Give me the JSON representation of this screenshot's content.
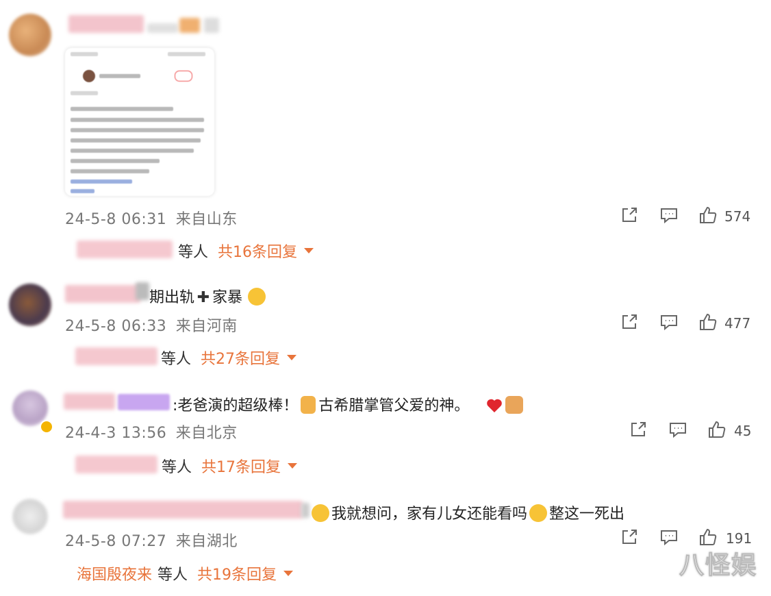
{
  "comments": [
    {
      "timestamp": "24-5-8 06:31",
      "location": "来自山东",
      "share_count": "",
      "comment_count": "",
      "likes": "574",
      "reply_who": "等人",
      "reply_total": "共16条回复"
    },
    {
      "text_a": "期出轨",
      "text_b": "家暴",
      "timestamp": "24-5-8 06:33",
      "location": "来自河南",
      "likes": "477",
      "reply_who": "等人",
      "reply_total": "共27条回复"
    },
    {
      "text_a": ":老爸演的超级棒！",
      "text_b": "古希腊掌管父爱的神。",
      "timestamp": "24-4-3 13:56",
      "location": "来自北京",
      "likes": "45",
      "reply_who": "等人",
      "reply_total": "共17条回复"
    },
    {
      "text_a": "我就想问，家有儿女还能看吗",
      "text_b": "整这一死出",
      "timestamp": "24-5-8 07:27",
      "location": "来自湖北",
      "likes": "191",
      "reply_name": "海国殷夜来",
      "reply_who": "等人",
      "reply_total": "共19条回复"
    }
  ],
  "watermark": "八怪娱",
  "icons": [
    "share-icon",
    "comment-icon",
    "like-icon",
    "chevron-down-icon"
  ],
  "colors": {
    "accent": "#e8743b",
    "meta": "#777777"
  }
}
